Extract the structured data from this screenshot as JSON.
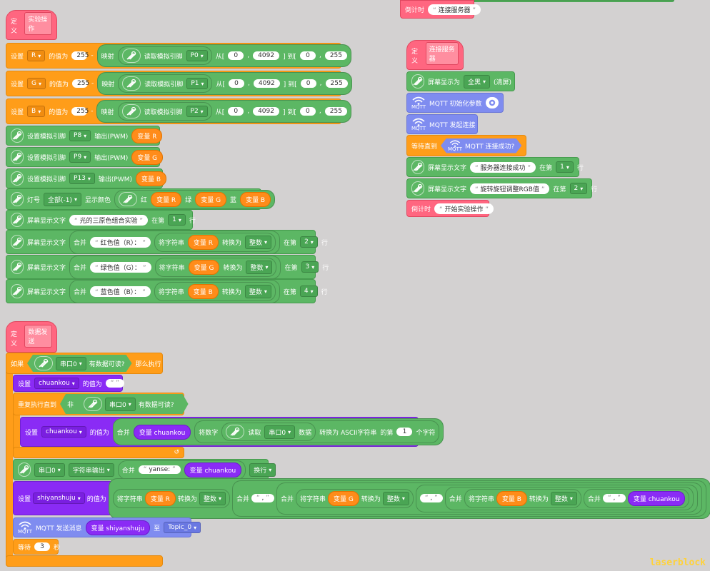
{
  "labels": {
    "define": "定义",
    "set": "设置",
    "value_of": "的值为",
    "map": "映射",
    "read_analog": "读取模拟引脚",
    "from": "从[",
    "to": "] 到[",
    "set_analog": "设置模拟引脚",
    "output_pwm": "输出(PWM)",
    "led": "灯号",
    "show_color": "显示颜色",
    "red": "红",
    "green_l": "绿",
    "blue": "蓝",
    "screen_text": "屏幕显示文字",
    "at_line": "在第",
    "line": "行",
    "merge": "合并",
    "str_to": "将字符串",
    "convert": "转换为",
    "if": "如果",
    "then": "那么执行",
    "has_data": "有数据可读?",
    "repeat_until": "重复执行直到",
    "not": "非",
    "read": "读取",
    "data": "数据",
    "to_ascii": "转换为 ASCII字符串",
    "index_of": "的第",
    "nth_char": "个字符",
    "convert_num": "将数字",
    "str_output": "字符串输出",
    "mqtt_send": "MQTT 发送消息",
    "to2": "至",
    "wait": "等待",
    "seconds": "秒",
    "countdown": "倒计时",
    "screen_show": "屏幕显示为",
    "mqtt_init": "MQTT 初始化参数",
    "mqtt_connect": "MQTT 发起连接",
    "wait_until": "等待直到",
    "mqtt_ok": "MQTT 连接成功?",
    "minus": "-",
    "comma": ",",
    "mqtt_tag": "MQTT",
    "clear": "(清屏)"
  },
  "proc1": {
    "name": "实验操作",
    "vars": [
      "R",
      "G",
      "B"
    ],
    "pins": [
      "P0",
      "P1",
      "P2"
    ],
    "map_from": [
      "0",
      "4092"
    ],
    "map_to": [
      "0",
      "255"
    ],
    "base": "255",
    "pwm": [
      {
        "pin": "P8",
        "var": "变量 R"
      },
      {
        "pin": "P9",
        "var": "变量 G"
      },
      {
        "pin": "P13",
        "var": "变量 B"
      }
    ],
    "led_all": "全部(-1)",
    "led_vars": [
      "变量 R",
      "变量 G",
      "变量 B"
    ],
    "title_text": "光的三原色组合实验",
    "title_line": "1",
    "rows": [
      {
        "label": "红色值（R）：",
        "var": "变量 R",
        "line": "2"
      },
      {
        "label": "绿色值（G）：",
        "var": "变量 G",
        "line": "3"
      },
      {
        "label": "蓝色值（B）：",
        "var": "变量 B",
        "line": "4"
      }
    ],
    "int_type": "整数"
  },
  "proc2": {
    "name": "数据发送",
    "serial": "串口0",
    "var_chuankou": "chuankou",
    "var_chuankou_ref": "变量 chuankou",
    "empty": " ",
    "index": "1",
    "out_mode": "字符串输出",
    "prefix": "yanse:",
    "newline": "换行",
    "var_shiyan": "shiyanshuju",
    "var_shiyan_ref": "变量 shiyanshuju",
    "sep": ",",
    "topic": "Topic_0",
    "wait_s": "3"
  },
  "proc3": {
    "name": "连接服务器",
    "screen_mode": "全黑",
    "msg1": "服务器连接成功",
    "line1": "1",
    "msg2": "旋转旋钮调整RGB值",
    "line2": "2",
    "countdown_text": "开始实验操作"
  },
  "top_right": {
    "countdown_text": "连接服务器"
  },
  "watermark": "laserblock"
}
